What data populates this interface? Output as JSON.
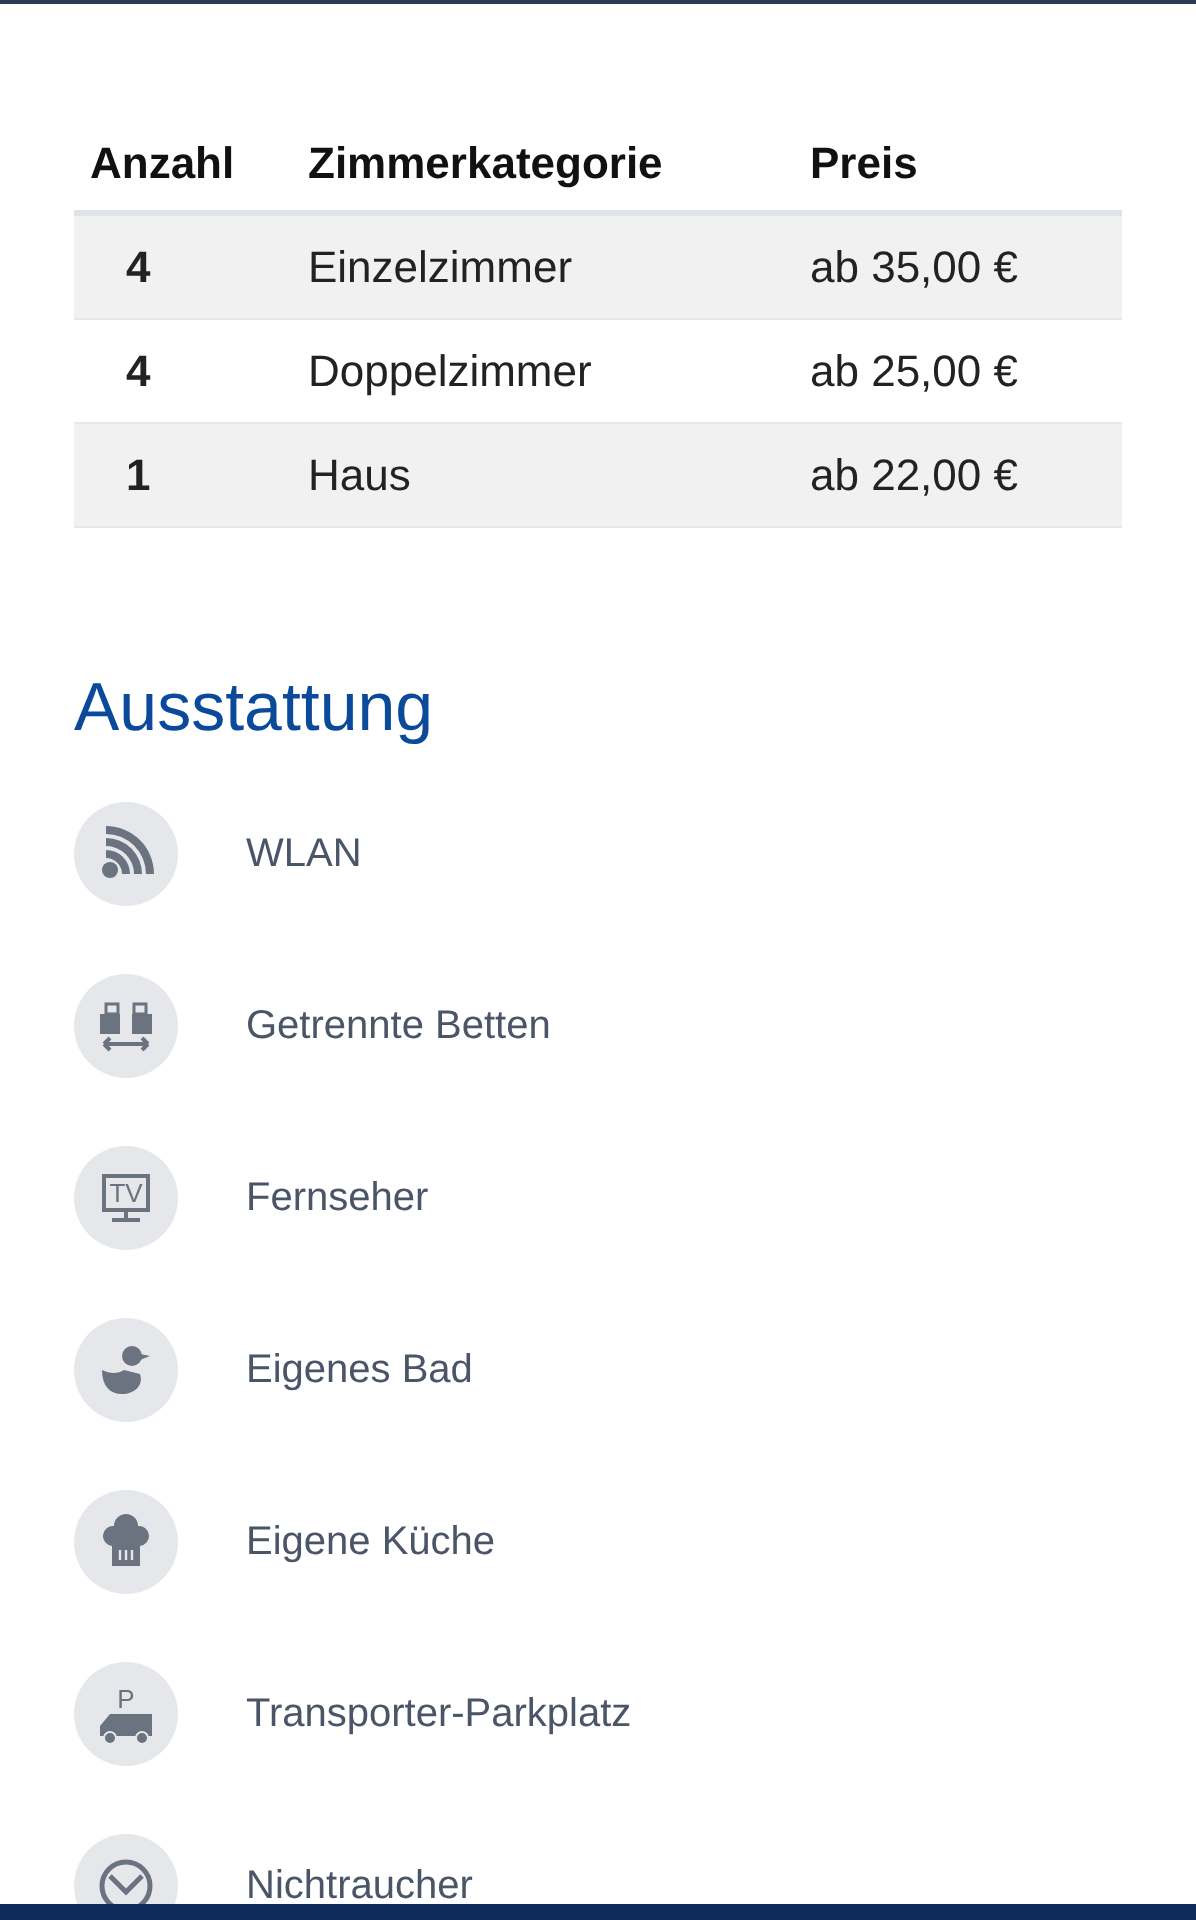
{
  "table": {
    "columns": [
      "Anzahl",
      "Zimmerkategorie",
      "Preis"
    ],
    "rows": [
      {
        "count": "4",
        "category": "Einzelzimmer",
        "price": "ab 35,00 €"
      },
      {
        "count": "4",
        "category": "Doppelzimmer",
        "price": "ab 25,00 €"
      },
      {
        "count": "1",
        "category": "Haus",
        "price": "ab 22,00 €"
      }
    ]
  },
  "amenities_title": "Ausstattung",
  "amenities": [
    {
      "kind": "wifi",
      "label": "WLAN"
    },
    {
      "kind": "beds",
      "label": "Getrennte Betten"
    },
    {
      "kind": "tv",
      "label": "Fernseher",
      "icon_text": "TV"
    },
    {
      "kind": "duck",
      "label": "Eigenes Bad"
    },
    {
      "kind": "chef",
      "label": "Eigene Küche"
    },
    {
      "kind": "van",
      "label": "Transporter-Parkplatz",
      "icon_text": "P"
    },
    {
      "kind": "nosmoke",
      "label": "Nichtraucher"
    }
  ]
}
